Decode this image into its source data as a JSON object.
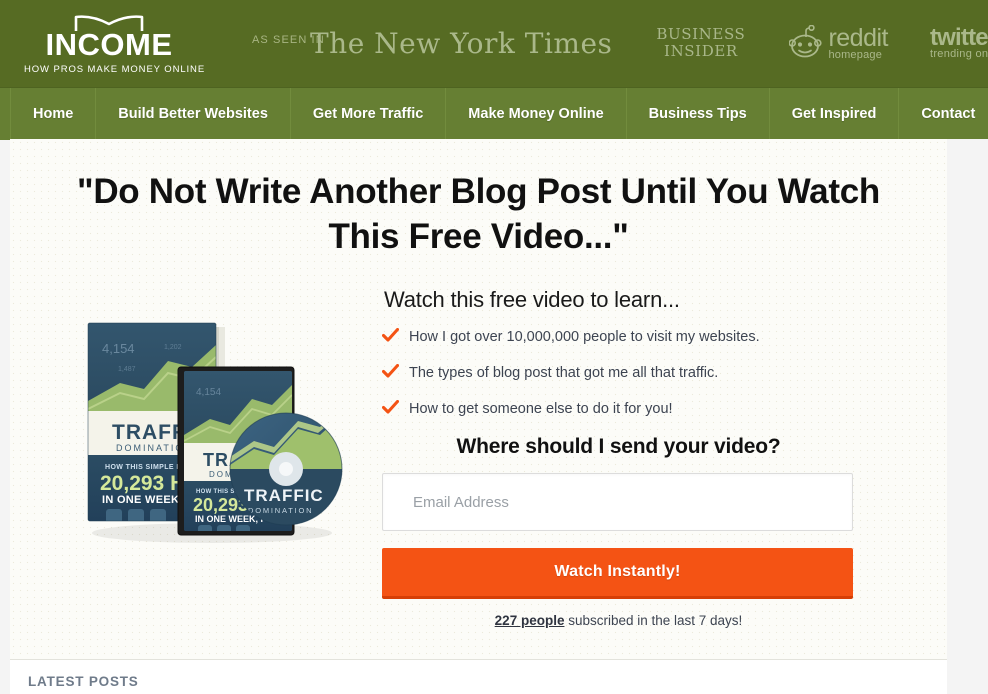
{
  "site": {
    "logo_word": "INCOME",
    "logo_tagline": "HOW PROS MAKE MONEY ONLINE",
    "logo_icon": "open-book-icon"
  },
  "press": {
    "label": "AS SEEN IN",
    "outlets": [
      {
        "name": "The New York Times",
        "sub": ""
      },
      {
        "name": "BUSINESS INSIDER",
        "line1": "BUSINESS",
        "line2": "INSIDER"
      },
      {
        "name": "reddit",
        "sub": "homepage"
      },
      {
        "name": "twitter",
        "sub": "trending on"
      }
    ]
  },
  "nav": {
    "items": [
      {
        "label": "Home"
      },
      {
        "label": "Build Better Websites"
      },
      {
        "label": "Get More Traffic"
      },
      {
        "label": "Make Money Online"
      },
      {
        "label": "Business Tips"
      },
      {
        "label": "Get Inspired"
      },
      {
        "label": "Contact"
      }
    ]
  },
  "hero": {
    "headline": "\"Do Not Write Another Blog Post Until You Watch This Free Video...\"",
    "subheading": "Watch this free video to learn...",
    "bullets": [
      "How I got over 10,000,000 people to visit my websites.",
      "The types of blog post that got me all that traffic.",
      "How to get someone else to do it for you!"
    ],
    "ask": "Where should I send your video?",
    "email_placeholder": "Email Address",
    "email_value": "",
    "cta_label": "Watch Instantly!",
    "social_proof_count": "227 people",
    "social_proof_rest": " subscribed in the last 7 days!"
  },
  "product": {
    "title": "TRAFFIC",
    "subtitle": "DOMINATION",
    "kicker": "HOW THIS SIMPLE BLOG POST GOT",
    "stat": "20,293 HITS",
    "stat_sub": "IN ONE WEEK, FOR FREE!",
    "chart_label": "4,154"
  },
  "sections": {
    "latest_posts": "LATEST POSTS"
  },
  "colors": {
    "header_green": "#566b23",
    "nav_green": "#667f33",
    "cta_orange": "#f45314",
    "cta_orange_dark": "#d63f06",
    "check_orange": "#f45314",
    "press_text": "#aab88a",
    "body_text": "#3d4451"
  }
}
